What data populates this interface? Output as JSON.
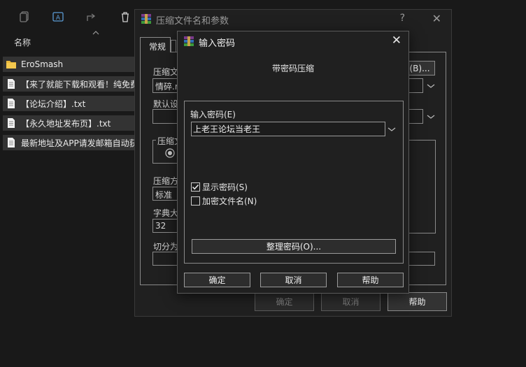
{
  "explorer": {
    "column_name": "名称",
    "files": [
      {
        "name": "EroSmash",
        "type": "folder"
      },
      {
        "name": "【来了就能下载和观看！纯免费",
        "type": "text"
      },
      {
        "name": "【论坛介绍】.txt",
        "type": "text"
      },
      {
        "name": "【永久地址发布页】.txt",
        "type": "text"
      },
      {
        "name": "最新地址及APP请发邮箱自动获",
        "type": "text"
      }
    ]
  },
  "main_dialog": {
    "title": "压缩文件名和参数",
    "help_q": "?",
    "close": "✕",
    "tab_general": "常规",
    "label_archive_name": "压缩文",
    "archive_name_value": "情碎.r",
    "browse_button": "(B)...",
    "label_default": "默认设",
    "group_format": "压缩文",
    "label_method": "压缩方",
    "method_value": "标准",
    "label_dict": "字典大",
    "dict_value": "32",
    "label_split": "切分为",
    "ok": "确定",
    "cancel": "取消",
    "help": "帮助"
  },
  "password_dialog": {
    "title": "输入密码",
    "close": "✕",
    "heading": "带密码压缩",
    "label_enter": "输入密码(E)",
    "password_value": "上老王论坛当老王",
    "show_password": "显示密码(S)",
    "show_password_checked": true,
    "encrypt_names": "加密文件名(N)",
    "encrypt_names_checked": false,
    "organize_button": "整理密码(O)...",
    "ok": "确定",
    "cancel": "取消",
    "help": "帮助"
  },
  "colors": {
    "background": "#191919",
    "dialog": "#202020",
    "folder": "#e8b73a"
  }
}
